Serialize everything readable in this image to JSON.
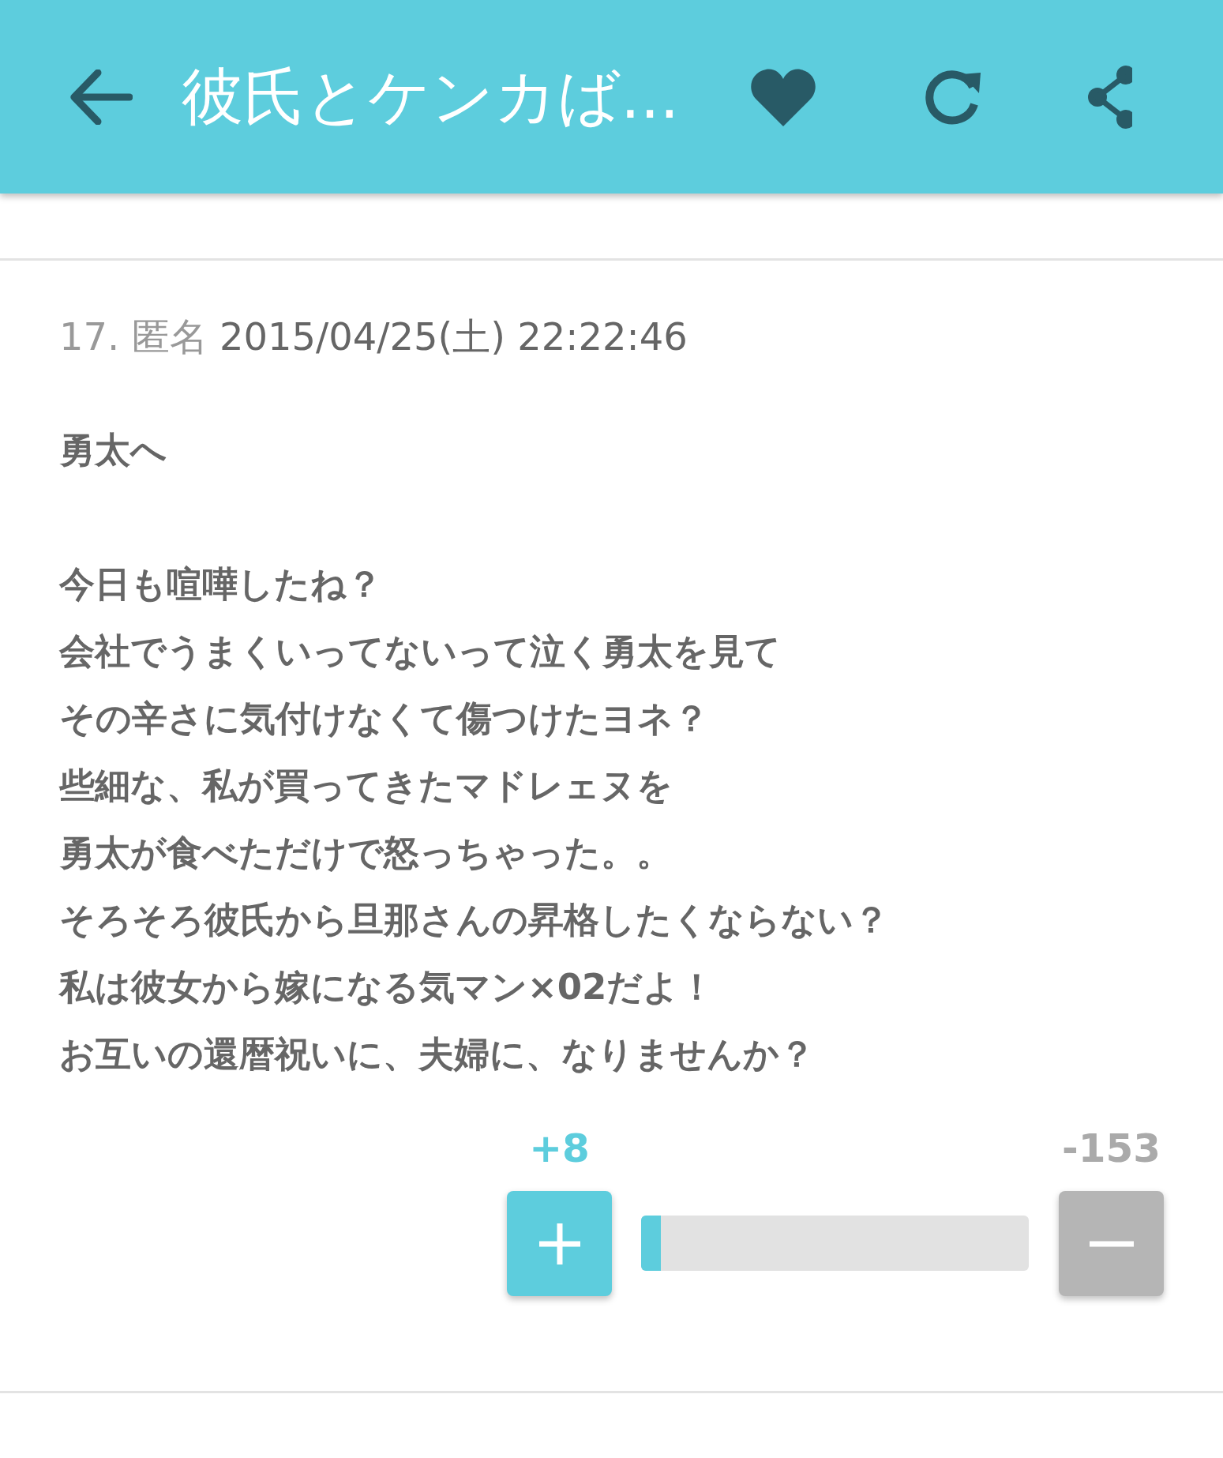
{
  "header": {
    "title": "彼氏とケンカば..."
  },
  "comment": {
    "number": "17.",
    "author": "匿名",
    "date": "2015/04/25(土) 22:22:46",
    "greeting": "勇太へ",
    "body": [
      "今日も喧嘩したね？",
      "会社でうまくいってないって泣く勇太を見て",
      "その辛さに気付けなくて傷つけたヨネ？",
      "些細な、私が買ってきたマドレェヌを",
      "勇太が食べただけで怒っちゃった。。",
      "そろそろ彼氏から旦那さんの昇格したくならない？",
      "私は彼女から嫁になる気マン×02だよ！",
      "お互いの還暦祝いに、夫婦に、なりませんか？"
    ]
  },
  "votes": {
    "plus": "+8",
    "minus": "-153",
    "level": 0.05
  }
}
